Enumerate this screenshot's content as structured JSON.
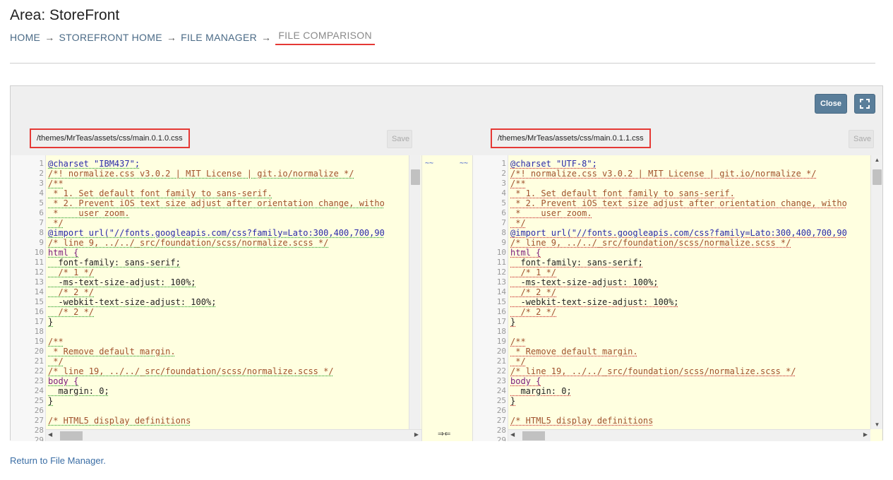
{
  "page": {
    "title": "Area: StoreFront"
  },
  "breadcrumb": {
    "items": [
      "HOME",
      "STOREFRONT HOME",
      "FILE MANAGER",
      "FILE COMPARISON"
    ],
    "separator": "→"
  },
  "toolbar": {
    "close_label": "Close",
    "fullscreen_icon": "fullscreen-icon"
  },
  "left_file": {
    "path": "/themes/MrTeas/assets/css/main.0.1.0.css",
    "save_label": "Save"
  },
  "right_file": {
    "path": "/themes/MrTeas/assets/css/main.0.1.1.css",
    "save_label": "Save"
  },
  "left_lines": [
    {
      "n": "1",
      "text": "@charset \"IBM437\";"
    },
    {
      "n": "2",
      "text": "/*! normalize.css v3.0.2 | MIT License | git.io/normalize */"
    },
    {
      "n": "3",
      "text": "/**"
    },
    {
      "n": "4",
      "text": " * 1. Set default font family to sans-serif."
    },
    {
      "n": "5",
      "text": " * 2. Prevent iOS text size adjust after orientation change, witho"
    },
    {
      "n": "6",
      "text": " *    user zoom."
    },
    {
      "n": "7",
      "text": " */"
    },
    {
      "n": "8",
      "text": "@import url(\"//fonts.googleapis.com/css?family=Lato:300,400,700,90"
    },
    {
      "n": "9",
      "text": "/* line 9, ../../_src/foundation/scss/normalize.scss */"
    },
    {
      "n": "10",
      "text": "html {"
    },
    {
      "n": "11",
      "text": "  font-family: sans-serif;"
    },
    {
      "n": "12",
      "text": "  /* 1 */"
    },
    {
      "n": "13",
      "text": "  -ms-text-size-adjust: 100%;"
    },
    {
      "n": "14",
      "text": "  /* 2 */"
    },
    {
      "n": "15",
      "text": "  -webkit-text-size-adjust: 100%;"
    },
    {
      "n": "16",
      "text": "  /* 2 */"
    },
    {
      "n": "17",
      "text": "}"
    },
    {
      "n": "18",
      "text": ""
    },
    {
      "n": "19",
      "text": "/**"
    },
    {
      "n": "20",
      "text": " * Remove default margin."
    },
    {
      "n": "21",
      "text": " */"
    },
    {
      "n": "22",
      "text": "/* line 19, ../../_src/foundation/scss/normalize.scss */"
    },
    {
      "n": "23",
      "text": "body {"
    },
    {
      "n": "24",
      "text": "  margin: 0;"
    },
    {
      "n": "25",
      "text": "}"
    },
    {
      "n": "26",
      "text": ""
    },
    {
      "n": "27",
      "text": "/* HTML5 display definitions"
    },
    {
      "n": "28",
      "text": ""
    },
    {
      "n": "29",
      "text": ""
    }
  ],
  "right_lines": [
    {
      "n": "1",
      "text": "@charset \"UTF-8\";"
    },
    {
      "n": "2",
      "text": "/*! normalize.css v3.0.2 | MIT License | git.io/normalize */"
    },
    {
      "n": "3",
      "text": "/**"
    },
    {
      "n": "4",
      "text": " * 1. Set default font family to sans-serif."
    },
    {
      "n": "5",
      "text": " * 2. Prevent iOS text size adjust after orientation change, witho"
    },
    {
      "n": "6",
      "text": " *    user zoom."
    },
    {
      "n": "7",
      "text": " */"
    },
    {
      "n": "8",
      "text": "@import url(\"//fonts.googleapis.com/css?family=Lato:300,400,700,90"
    },
    {
      "n": "9",
      "text": "/* line 9, ../../_src/foundation/scss/normalize.scss */"
    },
    {
      "n": "10",
      "text": "html {"
    },
    {
      "n": "11",
      "text": "  font-family: sans-serif;"
    },
    {
      "n": "12",
      "text": "  /* 1 */"
    },
    {
      "n": "13",
      "text": "  -ms-text-size-adjust: 100%;"
    },
    {
      "n": "14",
      "text": "  /* 2 */"
    },
    {
      "n": "15",
      "text": "  -webkit-text-size-adjust: 100%;"
    },
    {
      "n": "16",
      "text": "  /* 2 */"
    },
    {
      "n": "17",
      "text": "}"
    },
    {
      "n": "18",
      "text": ""
    },
    {
      "n": "19",
      "text": "/**"
    },
    {
      "n": "20",
      "text": " * Remove default margin."
    },
    {
      "n": "21",
      "text": " */"
    },
    {
      "n": "22",
      "text": "/* line 19, ../../_src/foundation/scss/normalize.scss */"
    },
    {
      "n": "23",
      "text": "body {"
    },
    {
      "n": "24",
      "text": "  margin: 0;"
    },
    {
      "n": "25",
      "text": "}"
    },
    {
      "n": "26",
      "text": ""
    },
    {
      "n": "27",
      "text": "/* HTML5 display definitions"
    },
    {
      "n": "28",
      "text": ""
    },
    {
      "n": "29",
      "text": ""
    }
  ],
  "merge": {
    "left_marker": "~~",
    "right_marker": "~~",
    "arrows": "⇒⇐"
  },
  "colors": {
    "diff_bg": "#ffffe0",
    "left_mark": "#2ca02c",
    "right_mark": "#c62828",
    "accent_button": "#5a7e9a",
    "highlight_border": "#e53935"
  },
  "footer": {
    "return_link": "Return to File Manager."
  }
}
